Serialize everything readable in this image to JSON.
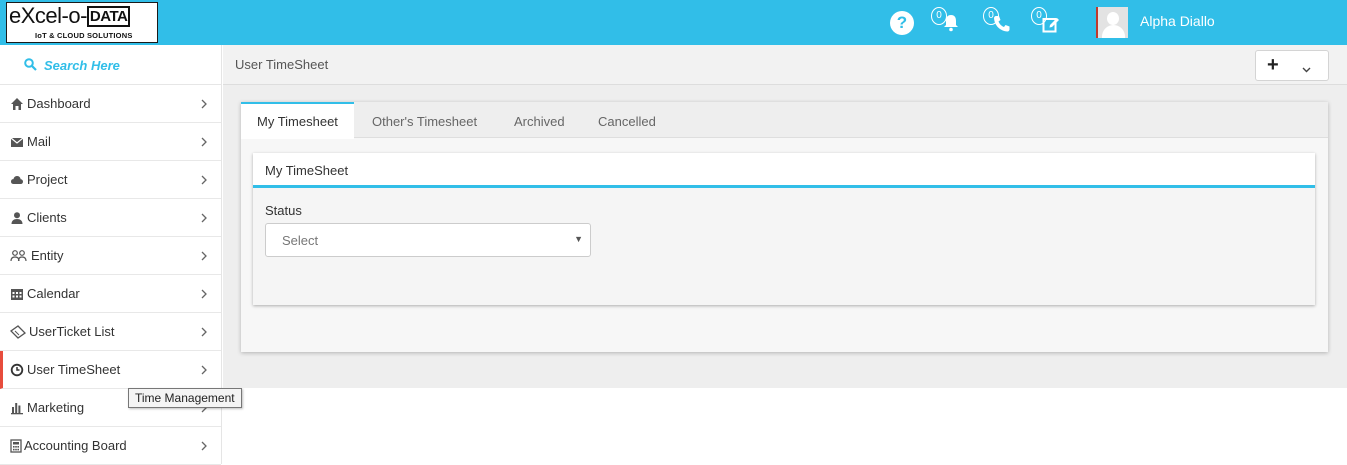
{
  "header": {
    "logo_main": "eXcel-o-",
    "logo_box": "DATA",
    "logo_sub": "IoT & CLOUD SOLUTIONS",
    "help_icon": "?",
    "notifications_count": "0",
    "calls_count": "0",
    "tasks_count": "0",
    "user_name": "Alpha Diallo",
    "accent_color": "#31bee8"
  },
  "sidebar": {
    "search_placeholder": "Search Here",
    "items": [
      {
        "label": "Dashboard",
        "icon": "home-icon"
      },
      {
        "label": "Mail",
        "icon": "envelope-icon"
      },
      {
        "label": "Project",
        "icon": "cloud-icon"
      },
      {
        "label": "Clients",
        "icon": "user-icon"
      },
      {
        "label": "Entity",
        "icon": "group-icon"
      },
      {
        "label": "Calendar",
        "icon": "calendar-icon"
      },
      {
        "label": "UserTicket List",
        "icon": "ticket-icon"
      },
      {
        "label": "User TimeSheet",
        "icon": "clock-icon",
        "active": true
      },
      {
        "label": "Marketing",
        "icon": "bar-chart-icon"
      },
      {
        "label": "Accounting Board",
        "icon": "calculator-icon"
      }
    ],
    "tooltip": "Time Management",
    "active_color": "#e74c3c"
  },
  "main": {
    "page_title": "User TimeSheet",
    "tabs": [
      {
        "label": "My Timesheet",
        "active": true
      },
      {
        "label": "Other's Timesheet"
      },
      {
        "label": "Archived"
      },
      {
        "label": "Cancelled"
      }
    ],
    "card_title": "My TimeSheet",
    "status_label": "Status",
    "status_value": "Select"
  }
}
